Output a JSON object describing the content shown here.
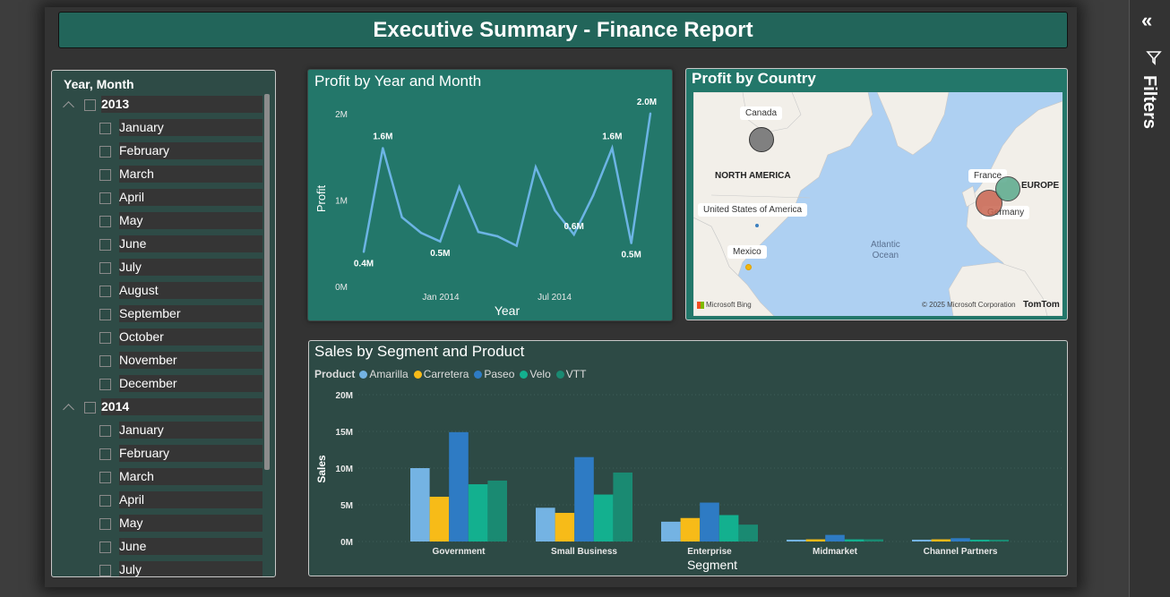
{
  "report_title": "Executive Summary - Finance Report",
  "filters_label": "Filters",
  "slicer": {
    "header": "Year, Month",
    "years": [
      {
        "year": "2013",
        "months": [
          "January",
          "February",
          "March",
          "April",
          "May",
          "June",
          "July",
          "August",
          "September",
          "October",
          "November",
          "December"
        ]
      },
      {
        "year": "2014",
        "months": [
          "January",
          "February",
          "March",
          "April",
          "May",
          "June",
          "July"
        ]
      }
    ]
  },
  "line_chart": {
    "title": "Profit by Year and Month",
    "chart_data": {
      "type": "line",
      "xlabel": "Year",
      "ylabel": "Profit",
      "x_ticks": [
        "Jan 2014",
        "Jul 2014"
      ],
      "y_ticks": [
        "0M",
        "1M",
        "2M"
      ],
      "ylim": [
        0,
        2.05
      ],
      "values": [
        0.4,
        1.6,
        0.8,
        0.62,
        0.52,
        1.15,
        0.63,
        0.58,
        0.47,
        1.38,
        0.88,
        0.6,
        1.05,
        1.6,
        0.5,
        2.0
      ],
      "data_labels": [
        {
          "index": 0,
          "text": "0.4M"
        },
        {
          "index": 1,
          "text": "1.6M"
        },
        {
          "index": 4,
          "text": "0.5M"
        },
        {
          "index": 11,
          "text": "0.6M"
        },
        {
          "index": 13,
          "text": "1.6M"
        },
        {
          "index": 14,
          "text": "0.5M"
        },
        {
          "index": 15,
          "text": "2.0M"
        }
      ],
      "color": "#6cb4e4"
    }
  },
  "map": {
    "title": "Profit by Country",
    "labels": [
      "Canada",
      "United States of America",
      "Mexico",
      "France",
      "Germany"
    ],
    "regions": [
      "NORTH AMERICA",
      "EUROPE"
    ],
    "ocean": [
      "Atlantic",
      "Ocean"
    ],
    "attribution_left": "Microsoft Bing",
    "attribution_right": "© 2025 Microsoft Corporation",
    "attribution_far": "TomTom",
    "colors": {
      "canada": "#808080",
      "france": "#5aa98c",
      "germany": "#c86450",
      "mexico": "#f2b60e",
      "usa": "#3c7fbf"
    }
  },
  "bar_chart": {
    "title": "Sales by Segment and Product",
    "legend_title": "Product",
    "chart_data": {
      "type": "bar",
      "xlabel": "Segment",
      "ylabel": "Sales",
      "categories": [
        "Government",
        "Small Business",
        "Enterprise",
        "Midmarket",
        "Channel Partners"
      ],
      "y_ticks": [
        "0M",
        "5M",
        "10M",
        "15M",
        "20M"
      ],
      "ylim": [
        0,
        20
      ],
      "series": [
        {
          "name": "Amarilla",
          "color": "#74b3e3",
          "values": [
            10.0,
            4.6,
            2.7,
            0.25,
            0.25
          ]
        },
        {
          "name": "Carretera",
          "color": "#f7bb18",
          "values": [
            6.1,
            3.9,
            3.2,
            0.3,
            0.3
          ]
        },
        {
          "name": "Paseo",
          "color": "#2e7bc4",
          "values": [
            14.9,
            11.5,
            5.3,
            0.9,
            0.45
          ]
        },
        {
          "name": "Velo",
          "color": "#13b08f",
          "values": [
            7.8,
            6.4,
            3.6,
            0.3,
            0.25
          ]
        },
        {
          "name": "VTT",
          "color": "#1a8a72",
          "values": [
            8.3,
            9.4,
            2.3,
            0.3,
            0.25
          ]
        }
      ]
    }
  }
}
